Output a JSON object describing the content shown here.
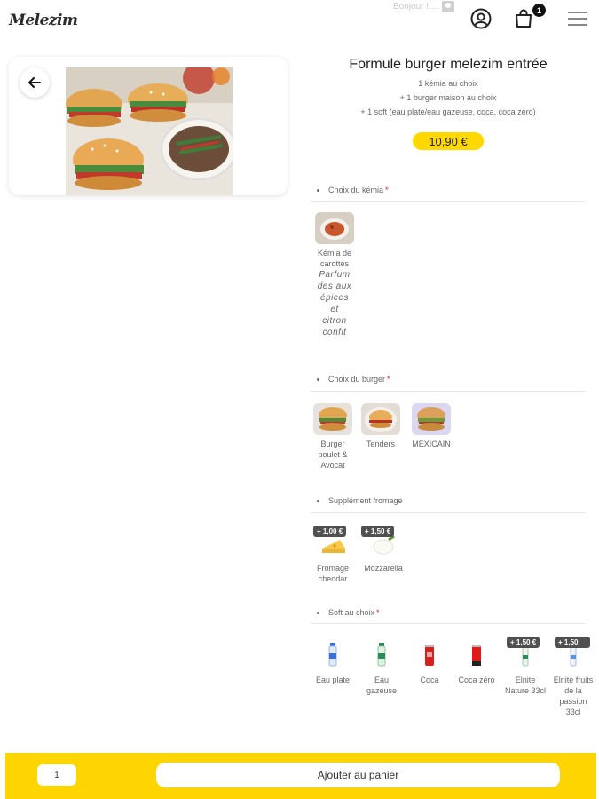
{
  "header": {
    "logo": "Melezim",
    "greeting": "Bonjour ! ...",
    "icons": {
      "account": "user-circle-icon",
      "cart": "shopping-bag-icon",
      "menu": "hamburger-menu-icon"
    },
    "cart_count": "1"
  },
  "product": {
    "title": "Formule burger melezim entrée",
    "description": [
      "1 kémia au choix",
      "+ 1 burger maison au choix",
      "+ 1 soft (eau plate/eau gazeuse, coca, coca zéro)"
    ],
    "price": "10,90 €"
  },
  "sections": {
    "kemia": {
      "title": "Choix du kémia",
      "required": "*",
      "options": [
        {
          "label": "Kémia de carottes",
          "extra": "Parfum des aux épices et citron confit"
        }
      ]
    },
    "burger": {
      "title": "Choix du burger",
      "required": "*",
      "options": [
        {
          "label": "Burger poulet & Avocat"
        },
        {
          "label": "Tenders"
        },
        {
          "label": "MEXICAIN"
        }
      ]
    },
    "fromage": {
      "title": "Supplément fromage",
      "options": [
        {
          "label": "Fromage cheddar",
          "surcharge": "+ 1,00 €"
        },
        {
          "label": "Mozzarella",
          "surcharge": "+ 1,50 €"
        }
      ]
    },
    "soft": {
      "title": "Soft au choix",
      "required": "*",
      "options": [
        {
          "label": "Eau plate"
        },
        {
          "label": "Eau gazeuse"
        },
        {
          "label": "Coca"
        },
        {
          "label": "Coca zéro"
        },
        {
          "label": "Elnite Nature 33cl",
          "surcharge": "+ 1,50 €"
        },
        {
          "label": "Elnite fruits de la passion 33cl",
          "surcharge": "+ 1,50"
        }
      ]
    }
  },
  "footer": {
    "quantity": "1",
    "add_to_cart": "Ajouter au panier"
  },
  "colors": {
    "accent": "#ffd800",
    "required": "#e02020",
    "badge": "#505050"
  }
}
